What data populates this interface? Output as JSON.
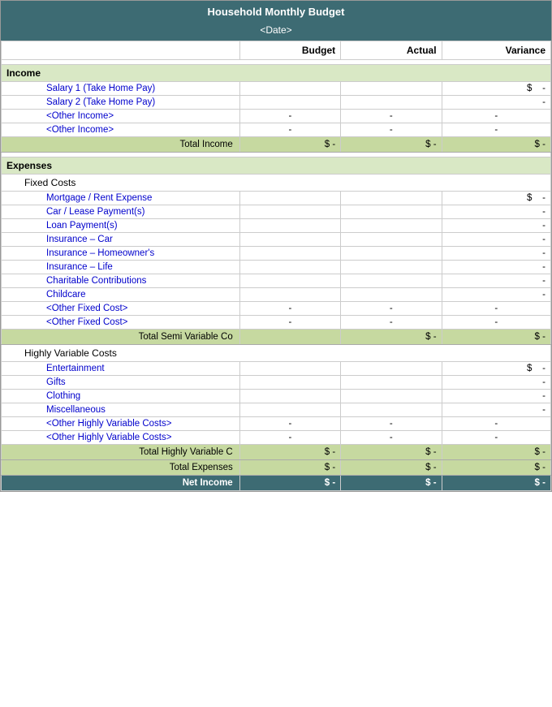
{
  "header": {
    "title": "Household Monthly Budget",
    "date_placeholder": "<Date>"
  },
  "columns": {
    "label": "",
    "budget": "Budget",
    "actual": "Actual",
    "variance": "Variance"
  },
  "sections": {
    "income": {
      "label": "Income",
      "items": [
        {
          "label": "Salary 1 (Take Home Pay)",
          "budget": "",
          "actual": "",
          "variance_prefix": "$",
          "variance": "-"
        },
        {
          "label": "Salary 2 (Take Home Pay)",
          "budget": "",
          "actual": "",
          "variance_prefix": "",
          "variance": "-"
        },
        {
          "label": "<Other Income>",
          "budget": "-",
          "actual": "-",
          "variance_prefix": "",
          "variance": "-"
        },
        {
          "label": "<Other Income>",
          "budget": "-",
          "actual": "-",
          "variance_prefix": "",
          "variance": "-"
        }
      ],
      "total": {
        "label": "Total Income",
        "budget_prefix": "$",
        "budget": "-",
        "actual_prefix": "$",
        "actual": "-",
        "variance_prefix": "$",
        "variance": "-"
      }
    },
    "expenses": {
      "label": "Expenses",
      "fixed_costs": {
        "label": "Fixed Costs",
        "items": [
          {
            "label": "Mortgage / Rent Expense",
            "budget": "",
            "actual": "",
            "variance_prefix": "$",
            "variance": "-"
          },
          {
            "label": "Car / Lease Payment(s)",
            "budget": "",
            "actual": "",
            "variance_prefix": "",
            "variance": "-"
          },
          {
            "label": "Loan Payment(s)",
            "budget": "",
            "actual": "",
            "variance_prefix": "",
            "variance": "-"
          },
          {
            "label": "Insurance – Car",
            "budget": "",
            "actual": "",
            "variance_prefix": "",
            "variance": "-"
          },
          {
            "label": "Insurance – Homeowner's",
            "budget": "",
            "actual": "",
            "variance_prefix": "",
            "variance": "-"
          },
          {
            "label": "Insurance – Life",
            "budget": "",
            "actual": "",
            "variance_prefix": "",
            "variance": "-"
          },
          {
            "label": "Charitable Contributions",
            "budget": "",
            "actual": "",
            "variance_prefix": "",
            "variance": "-"
          },
          {
            "label": "Childcare",
            "budget": "",
            "actual": "",
            "variance_prefix": "",
            "variance": "-"
          },
          {
            "label": "<Other Fixed Cost>",
            "budget": "-",
            "actual": "-",
            "variance_prefix": "",
            "variance": "-"
          },
          {
            "label": "<Other Fixed Cost>",
            "budget": "-",
            "actual": "-",
            "variance_prefix": "",
            "variance": "-"
          }
        ],
        "total": {
          "label": "Total Semi Variable Co",
          "budget_prefix": "",
          "budget": "",
          "actual_prefix": "$",
          "actual": "-",
          "variance_prefix": "$",
          "variance": "-"
        }
      },
      "highly_variable": {
        "label": "Highly Variable Costs",
        "items": [
          {
            "label": "Entertainment",
            "budget": "",
            "actual": "",
            "variance_prefix": "$",
            "variance": "-"
          },
          {
            "label": "Gifts",
            "budget": "",
            "actual": "",
            "variance_prefix": "",
            "variance": "-"
          },
          {
            "label": "Clothing",
            "budget": "",
            "actual": "",
            "variance_prefix": "",
            "variance": "-"
          },
          {
            "label": "Miscellaneous",
            "budget": "",
            "actual": "",
            "variance_prefix": "",
            "variance": "-"
          },
          {
            "label": "<Other Highly Variable Costs>",
            "budget": "-",
            "actual": "-",
            "variance_prefix": "",
            "variance": "-"
          },
          {
            "label": "<Other Highly Variable Costs>",
            "budget": "-",
            "actual": "-",
            "variance_prefix": "",
            "variance": "-"
          }
        ],
        "total_hv": {
          "label": "Total Highly Variable C",
          "budget_prefix": "$",
          "budget": "-",
          "actual_prefix": "$",
          "actual": "-",
          "variance_prefix": "$",
          "variance": "-"
        },
        "total_expenses": {
          "label": "Total Expenses",
          "budget_prefix": "$",
          "budget": "-",
          "actual_prefix": "$",
          "actual": "-",
          "variance_prefix": "$",
          "variance": "-"
        }
      }
    },
    "net_income": {
      "label": "Net Income",
      "budget_prefix": "$",
      "budget": "-",
      "actual_prefix": "$",
      "actual": "-",
      "variance_prefix": "$",
      "variance": "-"
    }
  }
}
